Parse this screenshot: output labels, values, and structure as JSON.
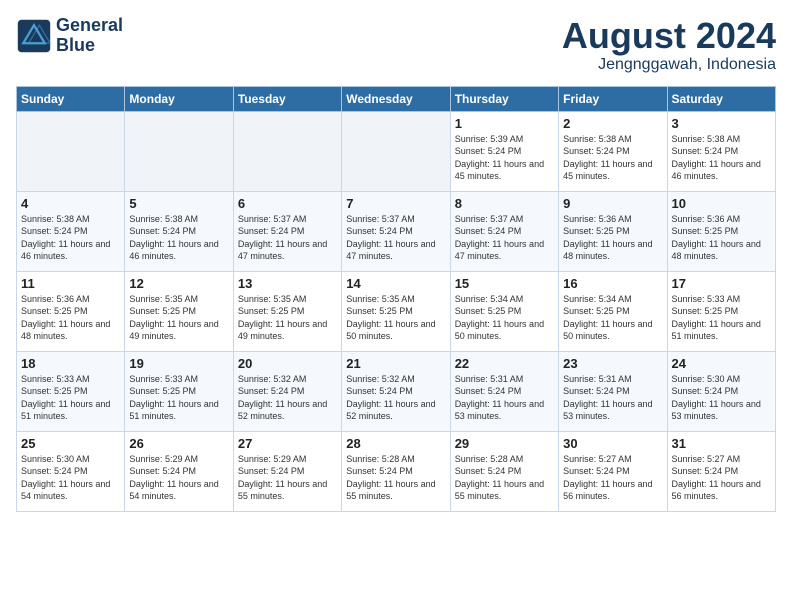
{
  "logo": {
    "line1": "General",
    "line2": "Blue"
  },
  "title": "August 2024",
  "subtitle": "Jengnggawah, Indonesia",
  "days_of_week": [
    "Sunday",
    "Monday",
    "Tuesday",
    "Wednesday",
    "Thursday",
    "Friday",
    "Saturday"
  ],
  "weeks": [
    [
      {
        "day": "",
        "empty": true
      },
      {
        "day": "",
        "empty": true
      },
      {
        "day": "",
        "empty": true
      },
      {
        "day": "",
        "empty": true
      },
      {
        "day": "1",
        "sunrise": "5:39 AM",
        "sunset": "5:24 PM",
        "daylight": "11 hours and 45 minutes."
      },
      {
        "day": "2",
        "sunrise": "5:38 AM",
        "sunset": "5:24 PM",
        "daylight": "11 hours and 45 minutes."
      },
      {
        "day": "3",
        "sunrise": "5:38 AM",
        "sunset": "5:24 PM",
        "daylight": "11 hours and 46 minutes."
      }
    ],
    [
      {
        "day": "4",
        "sunrise": "5:38 AM",
        "sunset": "5:24 PM",
        "daylight": "11 hours and 46 minutes."
      },
      {
        "day": "5",
        "sunrise": "5:38 AM",
        "sunset": "5:24 PM",
        "daylight": "11 hours and 46 minutes."
      },
      {
        "day": "6",
        "sunrise": "5:37 AM",
        "sunset": "5:24 PM",
        "daylight": "11 hours and 47 minutes."
      },
      {
        "day": "7",
        "sunrise": "5:37 AM",
        "sunset": "5:24 PM",
        "daylight": "11 hours and 47 minutes."
      },
      {
        "day": "8",
        "sunrise": "5:37 AM",
        "sunset": "5:24 PM",
        "daylight": "11 hours and 47 minutes."
      },
      {
        "day": "9",
        "sunrise": "5:36 AM",
        "sunset": "5:25 PM",
        "daylight": "11 hours and 48 minutes."
      },
      {
        "day": "10",
        "sunrise": "5:36 AM",
        "sunset": "5:25 PM",
        "daylight": "11 hours and 48 minutes."
      }
    ],
    [
      {
        "day": "11",
        "sunrise": "5:36 AM",
        "sunset": "5:25 PM",
        "daylight": "11 hours and 48 minutes."
      },
      {
        "day": "12",
        "sunrise": "5:35 AM",
        "sunset": "5:25 PM",
        "daylight": "11 hours and 49 minutes."
      },
      {
        "day": "13",
        "sunrise": "5:35 AM",
        "sunset": "5:25 PM",
        "daylight": "11 hours and 49 minutes."
      },
      {
        "day": "14",
        "sunrise": "5:35 AM",
        "sunset": "5:25 PM",
        "daylight": "11 hours and 50 minutes."
      },
      {
        "day": "15",
        "sunrise": "5:34 AM",
        "sunset": "5:25 PM",
        "daylight": "11 hours and 50 minutes."
      },
      {
        "day": "16",
        "sunrise": "5:34 AM",
        "sunset": "5:25 PM",
        "daylight": "11 hours and 50 minutes."
      },
      {
        "day": "17",
        "sunrise": "5:33 AM",
        "sunset": "5:25 PM",
        "daylight": "11 hours and 51 minutes."
      }
    ],
    [
      {
        "day": "18",
        "sunrise": "5:33 AM",
        "sunset": "5:25 PM",
        "daylight": "11 hours and 51 minutes."
      },
      {
        "day": "19",
        "sunrise": "5:33 AM",
        "sunset": "5:25 PM",
        "daylight": "11 hours and 51 minutes."
      },
      {
        "day": "20",
        "sunrise": "5:32 AM",
        "sunset": "5:24 PM",
        "daylight": "11 hours and 52 minutes."
      },
      {
        "day": "21",
        "sunrise": "5:32 AM",
        "sunset": "5:24 PM",
        "daylight": "11 hours and 52 minutes."
      },
      {
        "day": "22",
        "sunrise": "5:31 AM",
        "sunset": "5:24 PM",
        "daylight": "11 hours and 53 minutes."
      },
      {
        "day": "23",
        "sunrise": "5:31 AM",
        "sunset": "5:24 PM",
        "daylight": "11 hours and 53 minutes."
      },
      {
        "day": "24",
        "sunrise": "5:30 AM",
        "sunset": "5:24 PM",
        "daylight": "11 hours and 53 minutes."
      }
    ],
    [
      {
        "day": "25",
        "sunrise": "5:30 AM",
        "sunset": "5:24 PM",
        "daylight": "11 hours and 54 minutes."
      },
      {
        "day": "26",
        "sunrise": "5:29 AM",
        "sunset": "5:24 PM",
        "daylight": "11 hours and 54 minutes."
      },
      {
        "day": "27",
        "sunrise": "5:29 AM",
        "sunset": "5:24 PM",
        "daylight": "11 hours and 55 minutes."
      },
      {
        "day": "28",
        "sunrise": "5:28 AM",
        "sunset": "5:24 PM",
        "daylight": "11 hours and 55 minutes."
      },
      {
        "day": "29",
        "sunrise": "5:28 AM",
        "sunset": "5:24 PM",
        "daylight": "11 hours and 55 minutes."
      },
      {
        "day": "30",
        "sunrise": "5:27 AM",
        "sunset": "5:24 PM",
        "daylight": "11 hours and 56 minutes."
      },
      {
        "day": "31",
        "sunrise": "5:27 AM",
        "sunset": "5:24 PM",
        "daylight": "11 hours and 56 minutes."
      }
    ]
  ]
}
